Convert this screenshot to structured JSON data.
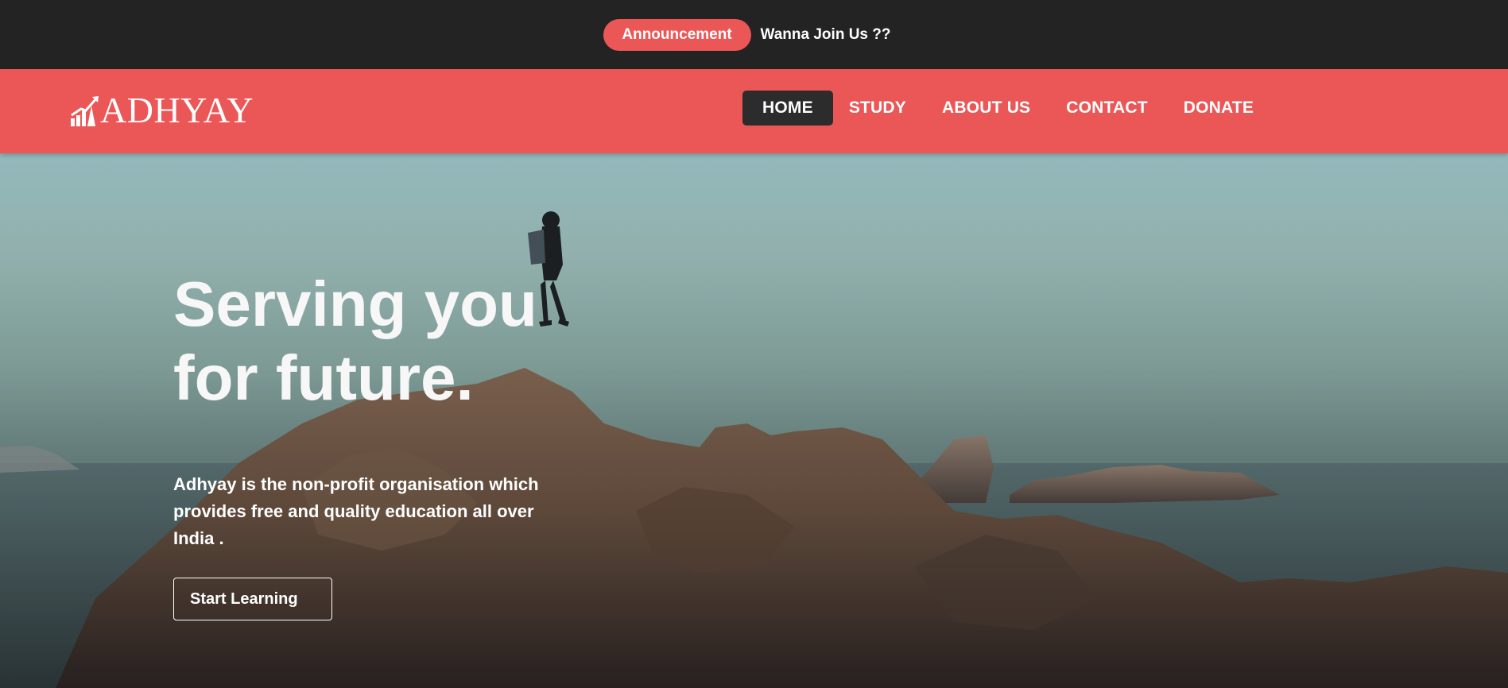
{
  "announcement": {
    "badge_label": "Announcement",
    "text": "Wanna Join Us ??"
  },
  "header": {
    "logo_text": "ADHYAY",
    "logo_icon": "growth-chart-icon",
    "nav": [
      {
        "label": "HOME",
        "active": true
      },
      {
        "label": "STUDY",
        "active": false
      },
      {
        "label": "ABOUT US",
        "active": false
      },
      {
        "label": "CONTACT",
        "active": false
      },
      {
        "label": "DONATE",
        "active": false
      }
    ]
  },
  "hero": {
    "title_line1": "Serving you",
    "title_line2": "for future.",
    "description": "Adhyay is the non-profit organisation which provides free and quality education all over India .",
    "cta_label": "Start Learning",
    "background": "hiker-on-rocky-cliff-photo"
  },
  "colors": {
    "accent": "#eb5757",
    "dark": "#232323",
    "active_nav": "#2c2c2c"
  }
}
